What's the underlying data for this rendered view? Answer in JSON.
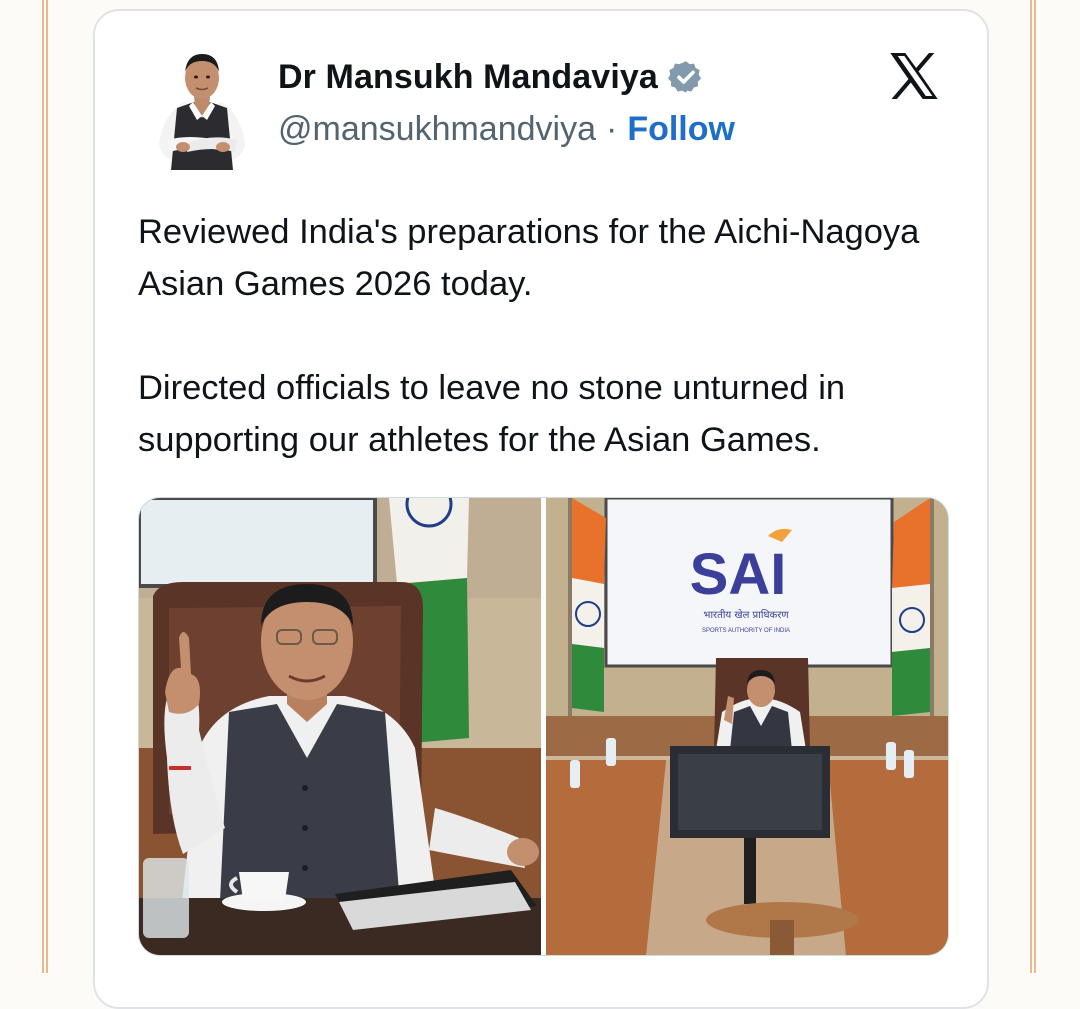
{
  "tweet": {
    "author_name": "Dr Mansukh Mandaviya",
    "handle": "@mansukhmandviya",
    "separator": "·",
    "follow_label": "Follow",
    "paragraphs": [
      "Reviewed India's preparations for the Aichi-Nagoya Asian Games 2026 today.",
      "Directed officials to leave no stone unturned in supporting our athletes for the Asian Games."
    ]
  },
  "media": {
    "screen_logo": "SAI",
    "screen_subtitle_hindi": "भारतीय खेल प्राधिकरण",
    "screen_subtitle_english": "SPORTS AUTHORITY OF INDIA"
  },
  "icons": {
    "verified": "verified-badge-icon",
    "brand": "x-logo-icon"
  },
  "colors": {
    "follow": "#1d6fc9",
    "handle": "#536471",
    "verified": "#829aab",
    "card_border": "#dfe3e6",
    "page_border": "#e8b98c"
  }
}
